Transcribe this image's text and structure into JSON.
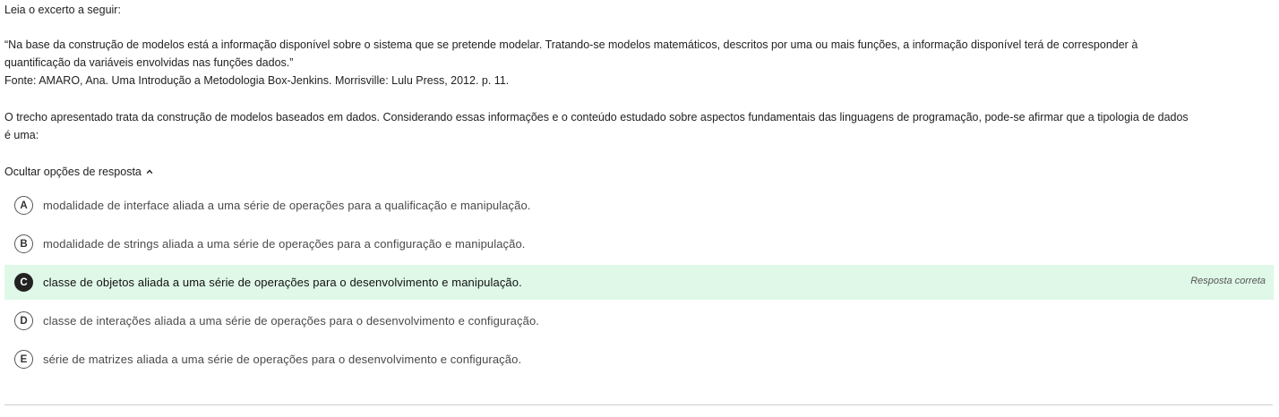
{
  "intro": "Leia o excerto a seguir:",
  "quote_line1": "“Na base da construção de modelos está a informação disponível sobre o sistema que se pretende modelar. Tratando-se modelos matemáticos, descritos por uma ou mais funções, a informação disponível terá de corresponder à",
  "quote_line2": "quantificação da variáveis envolvidas nas funções dados.”",
  "source": "Fonte: AMARO, Ana. Uma Introdução a Metodologia Box-Jenkins. Morrisville: Lulu Press, 2012. p. 11.",
  "question_line1": "O trecho apresentado trata da construção de modelos baseados em dados. Considerando essas informações e o conteúdo estudado sobre aspectos fundamentais das linguagens de programação, pode-se afirmar que a tipologia de dados",
  "question_line2": "é uma:",
  "toggle_label": "Ocultar opções de resposta",
  "toggle_icon": "chevron-up-icon",
  "options": [
    {
      "letter": "A",
      "text": "modalidade de interface aliada a uma série de operações para a qualificação e manipulação."
    },
    {
      "letter": "B",
      "text": "modalidade de strings aliada a uma série de operações para a configuração e manipulação."
    },
    {
      "letter": "C",
      "text": "classe de objetos aliada a uma série de operações para o desenvolvimento e manipulação.",
      "correct_label": "Resposta correta"
    },
    {
      "letter": "D",
      "text": "classe de interações aliada a uma série de operações para o desenvolvimento e configuração."
    },
    {
      "letter": "E",
      "text": "série de matrizes aliada a uma série de operações para o desenvolvimento e configuração."
    }
  ],
  "colors": {
    "correct_background": "#dff8e8",
    "correct_badge": "#222222"
  }
}
